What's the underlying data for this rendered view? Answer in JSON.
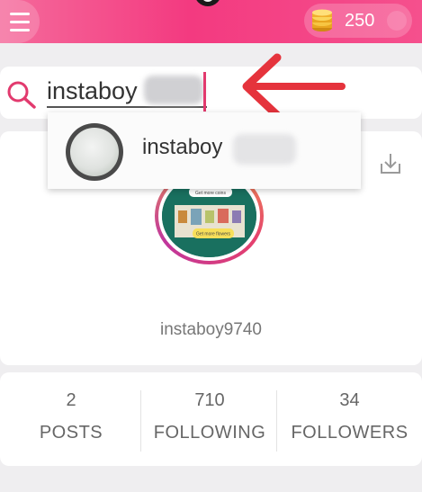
{
  "header": {
    "coin_count": "250",
    "accent_color": "#f33a80"
  },
  "search": {
    "value": "instaboy"
  },
  "suggestion": {
    "label": "instaboy"
  },
  "profile": {
    "username": "instaboy9740",
    "avatar_badges": [
      "Get more coins",
      "Get more flowers"
    ]
  },
  "stats": [
    {
      "value": "2",
      "label": "POSTS"
    },
    {
      "value": "710",
      "label": "FOLLOWING"
    },
    {
      "value": "34",
      "label": "FOLLOWERS"
    }
  ],
  "icons": [
    "menu-icon",
    "coin-stack-icon",
    "search-icon",
    "download-icon",
    "red-arrow-annotation"
  ]
}
